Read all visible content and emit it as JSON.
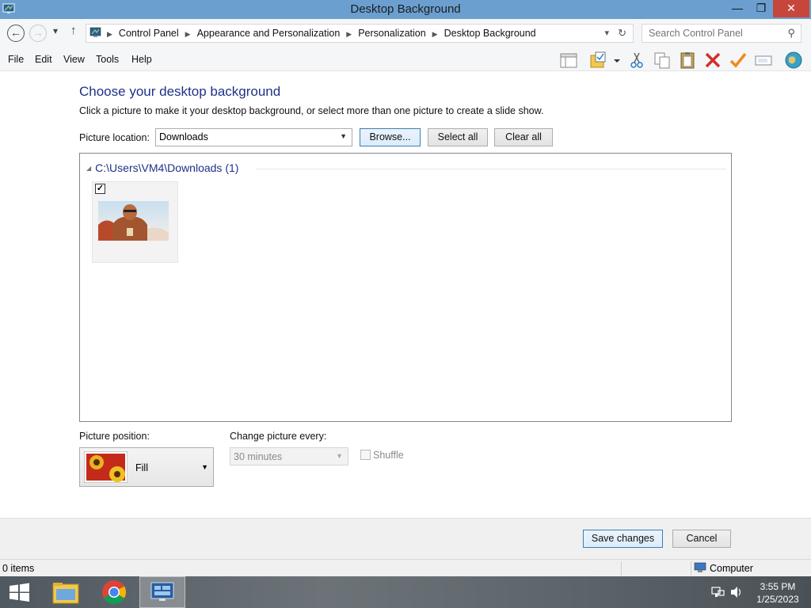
{
  "window": {
    "title": "Desktop Background",
    "min_glyph": "—",
    "max_glyph": "❐",
    "close_glyph": "✕"
  },
  "address": {
    "back_glyph": "←",
    "forward_glyph": "→",
    "recent_glyph": "▾",
    "up_glyph": "↑",
    "breadcrumbs": [
      "Control Panel",
      "Appearance and Personalization",
      "Personalization",
      "Desktop Background"
    ],
    "dropdown_glyph": "▾",
    "refresh_glyph": "↻",
    "search_placeholder": "Search Control Panel",
    "search_glyph": "⚲"
  },
  "menu": [
    "File",
    "Edit",
    "View",
    "Tools",
    "Help"
  ],
  "toolbar_icons": [
    "layout-pane-icon",
    "folder-properties-icon",
    "dropdown-arrow-icon",
    "cut-icon",
    "copy-icon",
    "paste-icon",
    "delete-icon",
    "checkmark-icon",
    "rename-icon",
    "globe-icon"
  ],
  "content": {
    "heading": "Choose your desktop background",
    "subtext": "Click a picture to make it your desktop background, or select more than one picture to create a slide show.",
    "picture_location_label": "Picture location:",
    "picture_location_value": "Downloads",
    "browse_label": "Browse...",
    "select_all_label": "Select all",
    "clear_all_label": "Clear all",
    "group_header": "C:\\Users\\VM4\\Downloads (1)",
    "pictures": [
      {
        "checked": true,
        "check_glyph": "✓"
      }
    ],
    "picture_position_label": "Picture position:",
    "picture_position_value": "Fill",
    "change_every_label": "Change picture every:",
    "change_every_value": "30 minutes",
    "shuffle_label": "Shuffle",
    "save_label": "Save changes",
    "cancel_label": "Cancel",
    "select_arrow_glyph": "▼",
    "group_collapse_glyph": "◢"
  },
  "status": {
    "items_text": "0 items",
    "location_text": "Computer"
  },
  "taskbar": {
    "time": "3:55 PM",
    "date": "1/25/2023",
    "apps": [
      "start-button",
      "file-explorer",
      "chrome",
      "control-panel"
    ]
  },
  "colors": {
    "titlebar": "#6a9fd0",
    "heading": "#1e3287",
    "close_button": "#c7463b"
  }
}
